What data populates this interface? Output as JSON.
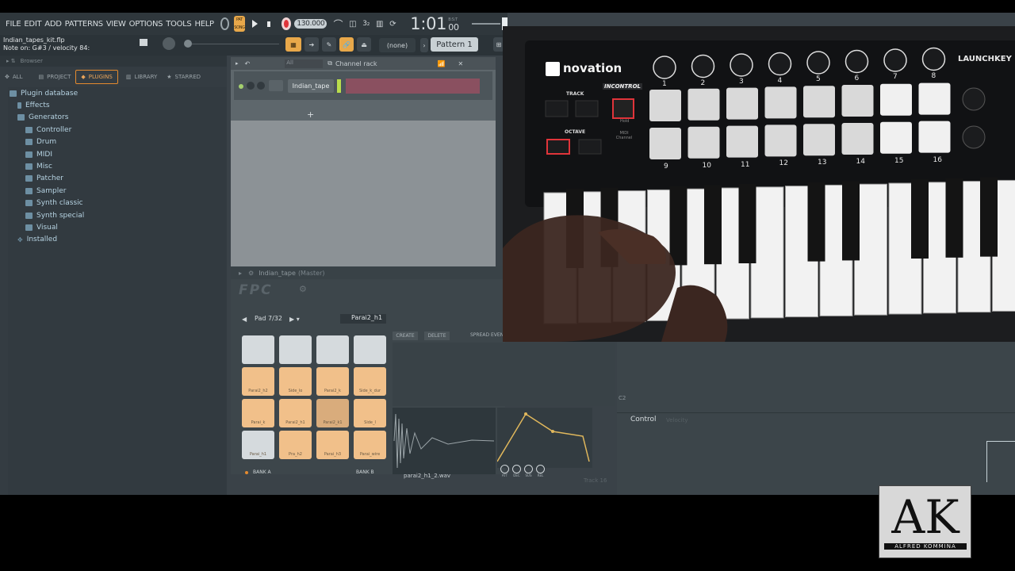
{
  "menu": {
    "items": [
      "FILE",
      "EDIT",
      "ADD",
      "PATTERNS",
      "VIEW",
      "OPTIONS",
      "TOOLS",
      "HELP"
    ]
  },
  "transport": {
    "pat_label": "PAT",
    "song_label": "SONG",
    "tempo": "130.000",
    "time": "1:01",
    "time_sub": "00",
    "time_bst": "B:S:T",
    "pattern_name": "Pattern 1",
    "none_label": "(none)"
  },
  "hint": {
    "file": "Indian_tapes_kit.flp",
    "note": "Note on: G#3 / velocity 84:"
  },
  "browser": {
    "header": "Browser",
    "tabs": [
      "ALL",
      "PROJECT",
      "PLUGINS",
      "LIBRARY",
      "STARRED"
    ],
    "active_tab": "PLUGINS",
    "root": "Plugin database",
    "items": [
      {
        "label": "Effects",
        "level": 1
      },
      {
        "label": "Generators",
        "level": 1
      },
      {
        "label": "Controller",
        "level": 2
      },
      {
        "label": "Drum",
        "level": 2
      },
      {
        "label": "MIDI",
        "level": 2
      },
      {
        "label": "Misc",
        "level": 2
      },
      {
        "label": "Patcher",
        "level": 2
      },
      {
        "label": "Sampler",
        "level": 2
      },
      {
        "label": "Synth classic",
        "level": 2
      },
      {
        "label": "Synth special",
        "level": 2
      },
      {
        "label": "Visual",
        "level": 2
      }
    ],
    "installed": "Installed"
  },
  "channel_rack": {
    "filter": "All",
    "title": "Channel rack",
    "channel_name": "Indian_tape"
  },
  "fpc": {
    "title": "Indian_tape",
    "title_suffix": "(Master)",
    "pad_label": "Pad 7/32",
    "pad_name": "Parai2_h1",
    "create": "CREATE",
    "delete": "DELETE",
    "spread": "SPREAD EVEN",
    "bank_a": "BANK A",
    "bank_b": "BANK B",
    "wav_file": "parai2_h1_2.wav",
    "env_labels": [
      "ATT",
      "DEC",
      "SUS",
      "REL"
    ],
    "pads": [
      {
        "label": "",
        "color": "white"
      },
      {
        "label": "",
        "color": "white"
      },
      {
        "label": "",
        "color": "white"
      },
      {
        "label": "",
        "color": "white"
      },
      {
        "label": "Parai2_h2",
        "color": "orange"
      },
      {
        "label": "Side_lo",
        "color": "orange"
      },
      {
        "label": "Parai2_k",
        "color": "orange"
      },
      {
        "label": "Side_k_dur",
        "color": "orange"
      },
      {
        "label": "Parai_k",
        "color": "orange"
      },
      {
        "label": "Parai2_h1",
        "color": "orange"
      },
      {
        "label": "Parai2_k1",
        "color": "orange-dim"
      },
      {
        "label": "Side_l",
        "color": "orange"
      },
      {
        "label": "Parai_h1",
        "color": "white"
      },
      {
        "label": "Pra_h2",
        "color": "orange"
      },
      {
        "label": "Parai_h3",
        "color": "orange"
      },
      {
        "label": "Parai_wire",
        "color": "orange"
      }
    ]
  },
  "playlist": {
    "c2_label": "C2",
    "control_label": "Control",
    "velocity_label": "Velocity",
    "track_label": "Track 16"
  },
  "video": {
    "brand": "novation",
    "incontrol": "INCONTROL",
    "model": "LAUNCHKEY",
    "track_label": "TRACK",
    "octave_label": "OCTAVE",
    "hold_label": "Hold",
    "midi_channel_label": "MIDI Channel",
    "knob_numbers": [
      "1",
      "2",
      "3",
      "4",
      "5",
      "6",
      "7",
      "8"
    ],
    "pad_numbers": [
      "9",
      "10",
      "11",
      "12",
      "13",
      "14",
      "15",
      "16"
    ]
  },
  "watermark": {
    "initials": "AK",
    "name": "ALFRED KOMMINA"
  },
  "colors": {
    "accent_orange": "#e48a2e",
    "record_red": "#e0343a",
    "pad_orange": "#f1c08a",
    "tree_text": "#b6d3e2",
    "channel_red": "#8a5060"
  }
}
